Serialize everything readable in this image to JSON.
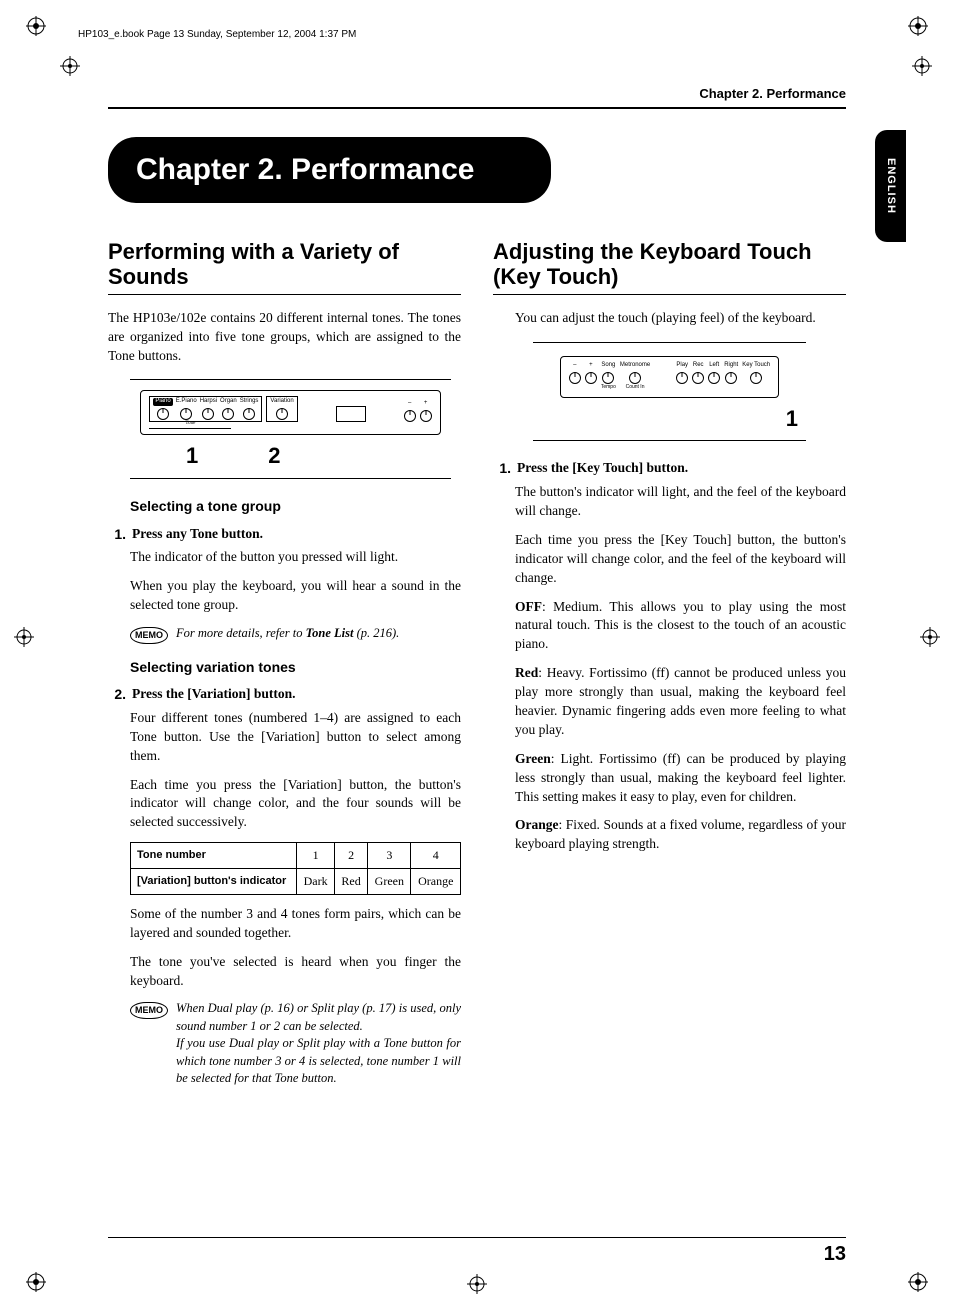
{
  "meta": {
    "header_line": "HP103_e.book  Page 13  Sunday, September 12, 2004  1:37 PM",
    "chapter_ref": "Chapter 2. Performance",
    "lang_tab": "ENGLISH",
    "page_number": "13"
  },
  "chapter_title": "Chapter 2. Performance",
  "left": {
    "h2": "Performing with a Variety of Sounds",
    "intro": "The HP103e/102e contains 20 different internal tones. The tones are organized into five tone groups, which are assigned to the Tone buttons.",
    "fig1": {
      "labels": [
        "Piano",
        "E.Piano",
        "Harpsi",
        "Organ",
        "Strings",
        "Variation"
      ],
      "tone_label": "Tone",
      "minus": "–",
      "plus": "+",
      "num1": "1",
      "num2": "2"
    },
    "sub1": "Selecting a tone group",
    "step1_num": "1.",
    "step1_title": "Press any Tone button.",
    "step1_p1": "The indicator of the button you pressed will light.",
    "step1_p2": "When you play the keyboard, you will hear a sound in the selected tone group.",
    "memo1_pre": "For more details, refer to ",
    "memo1_bold": "Tone List",
    "memo1_post": " (p. 216).",
    "sub2": "Selecting variation tones",
    "step2_num": "2.",
    "step2_title": "Press the [Variation] button.",
    "step2_p1": "Four different tones (numbered 1–4) are assigned to each Tone button. Use the [Variation] button to select among them.",
    "step2_p2": "Each time you press the [Variation] button, the button's indicator will change color, and the four sounds will be selected successively.",
    "table": {
      "h1": "Tone number",
      "c1": "1",
      "c2": "2",
      "c3": "3",
      "c4": "4",
      "h2": "[Variation] button's indicator",
      "v1": "Dark",
      "v2": "Red",
      "v3": "Green",
      "v4": "Orange"
    },
    "after_table_p1": "Some of the number 3 and 4 tones form pairs, which can be layered and sounded together.",
    "after_table_p2": "The tone you've selected is heard when you finger the keyboard.",
    "memo2_l1": "When Dual play (p. 16) or Split play (p. 17) is used, only sound number 1 or 2 can be selected.",
    "memo2_l2": "If you use Dual play or Split play with a Tone button for which tone number 3 or 4 is selected, tone number 1 will be selected for that Tone button.",
    "memo_label": "MEMO"
  },
  "right": {
    "h2": "Adjusting the Keyboard Touch (Key Touch)",
    "intro": "You can adjust the touch (playing feel) of the keyboard.",
    "fig2": {
      "top_labels_l": [
        "–",
        "+",
        "Song",
        "Metronome"
      ],
      "top_labels_r": [
        "Play",
        "Rec",
        "Left",
        "Right",
        "Key Touch"
      ],
      "sub_labels": [
        "Tempo",
        "Count In"
      ],
      "num1": "1"
    },
    "step1_num": "1.",
    "step1_title": "Press the [Key Touch] button.",
    "p1": "The button's indicator will light, and the feel of the keyboard will change.",
    "p2": "Each time you press the [Key Touch] button, the button's indicator will change color, and the feel of the keyboard will change.",
    "off_b": "OFF",
    "off_t": ": Medium. This allows you to play using the most natural touch. This is the closest to the touch of an acoustic piano.",
    "red_b": "Red",
    "red_t": ": Heavy. Fortissimo (ff) cannot be produced unless you play more strongly than usual, making the keyboard feel heavier. Dynamic fingering adds even more feeling to what you play.",
    "green_b": "Green",
    "green_t": ": Light. Fortissimo (ff) can be produced by playing less strongly than usual, making the keyboard feel lighter. This setting makes it easy to play, even for children.",
    "orange_b": "Orange",
    "orange_t": ": Fixed. Sounds at a fixed volume, regardless of your keyboard playing strength."
  }
}
